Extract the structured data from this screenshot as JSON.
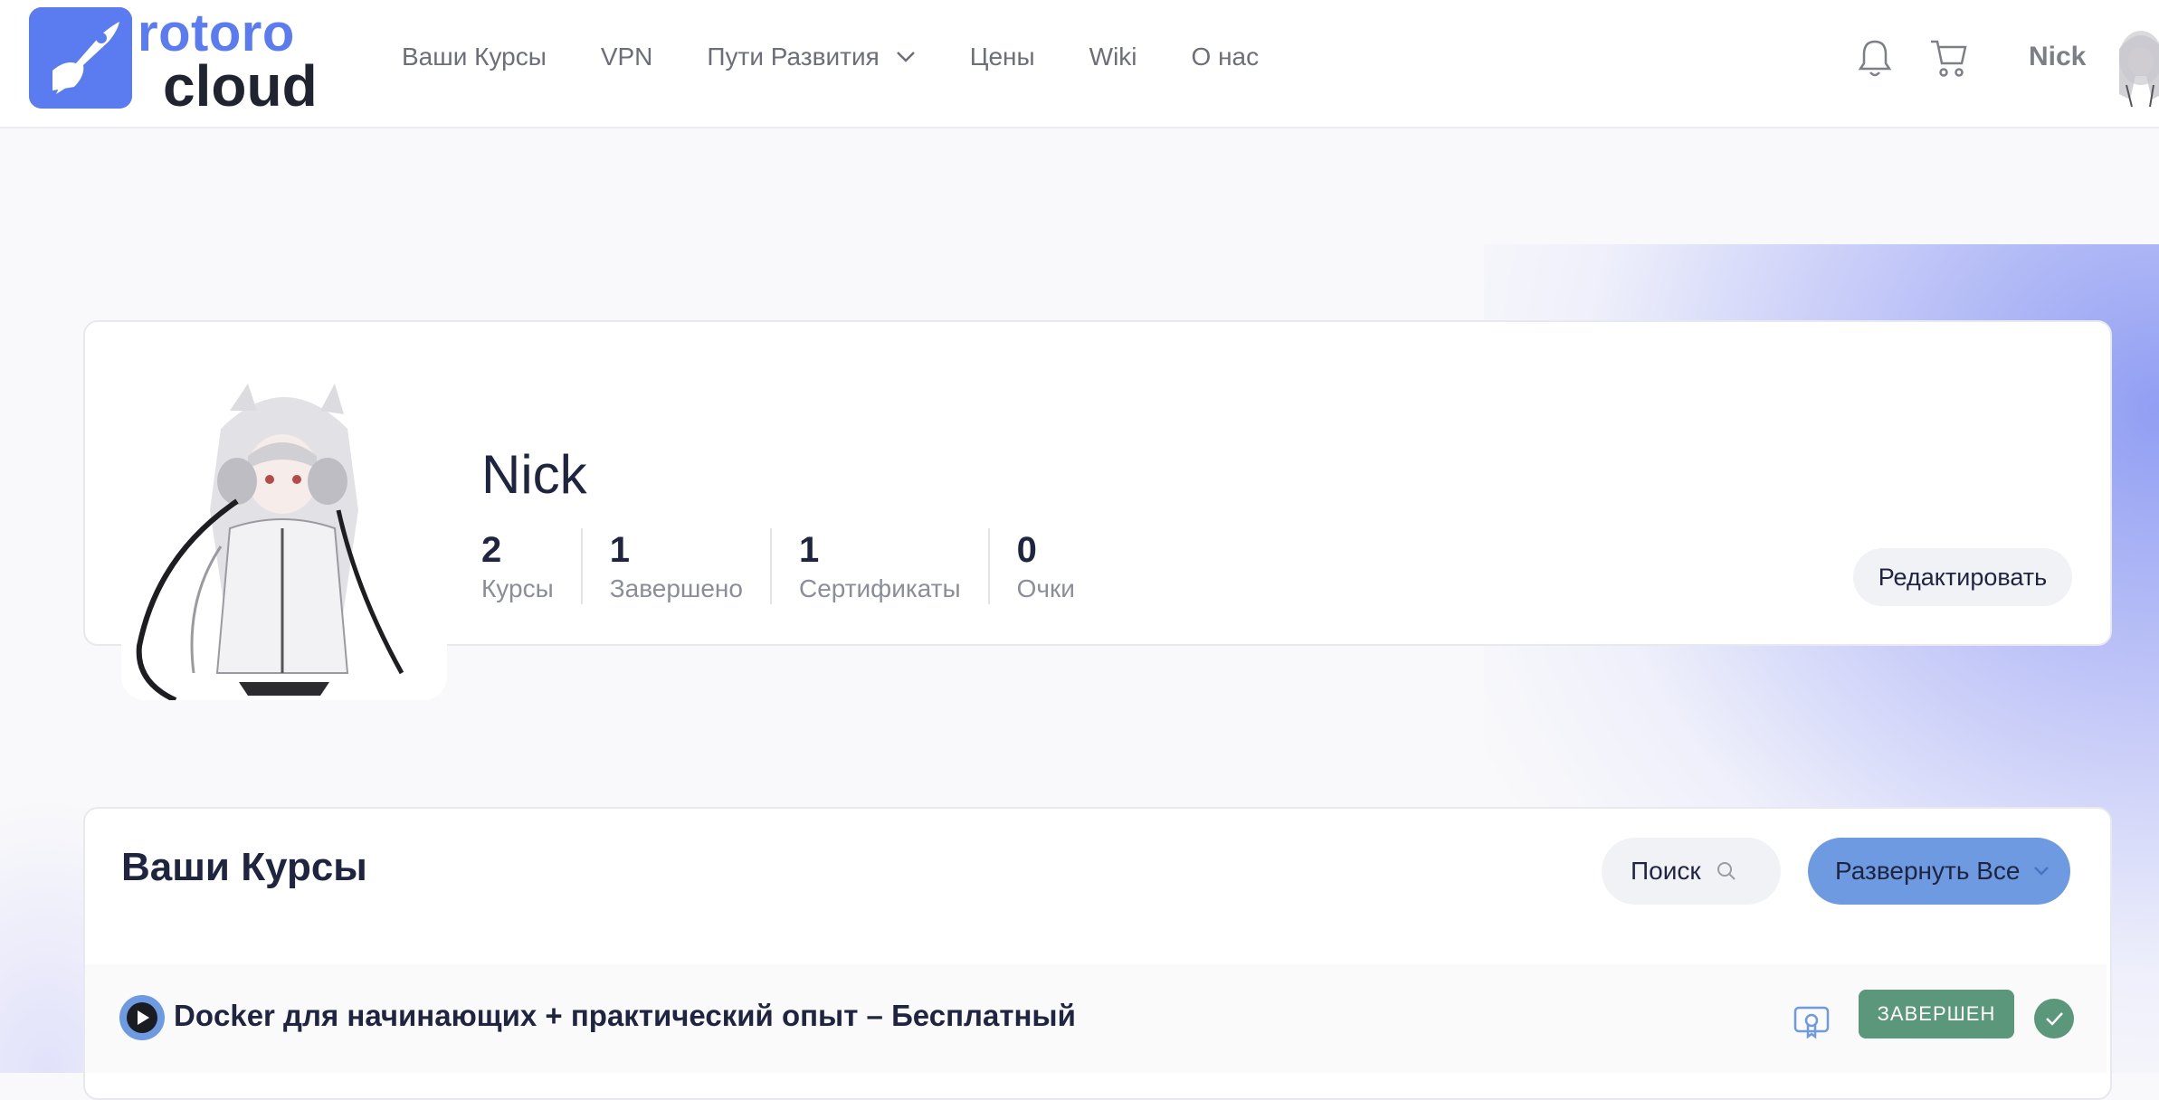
{
  "logo": {
    "line1": "rotoro",
    "line2": "cloud"
  },
  "nav": {
    "items": [
      {
        "label": "Ваши Курсы"
      },
      {
        "label": "VPN"
      },
      {
        "label": "Пути Развития",
        "has_dropdown": true
      },
      {
        "label": "Цены"
      },
      {
        "label": "Wiki"
      },
      {
        "label": "О нас"
      }
    ]
  },
  "header": {
    "user_name": "Nick",
    "icons": [
      "bell-icon",
      "cart-icon",
      "avatar"
    ]
  },
  "profile": {
    "name": "Nick",
    "stats": [
      {
        "value": "2",
        "label": "Курсы"
      },
      {
        "value": "1",
        "label": "Завершено"
      },
      {
        "value": "1",
        "label": "Сертификаты"
      },
      {
        "value": "0",
        "label": "Очки"
      }
    ],
    "edit_label": "Редактировать"
  },
  "courses": {
    "title": "Ваши Курсы",
    "search_label": "Поиск",
    "expand_label": "Развернуть Все",
    "items": [
      {
        "title": "Docker для начинающих + практический опыт – Бесплатный",
        "status": "ЗАВЕРШЕН"
      }
    ]
  },
  "colors": {
    "accent": "#5b7cf0",
    "button_blue": "#6d9ae1",
    "success": "#5b977a",
    "text_dark": "#1f2540",
    "text_muted": "#8b8e98"
  }
}
